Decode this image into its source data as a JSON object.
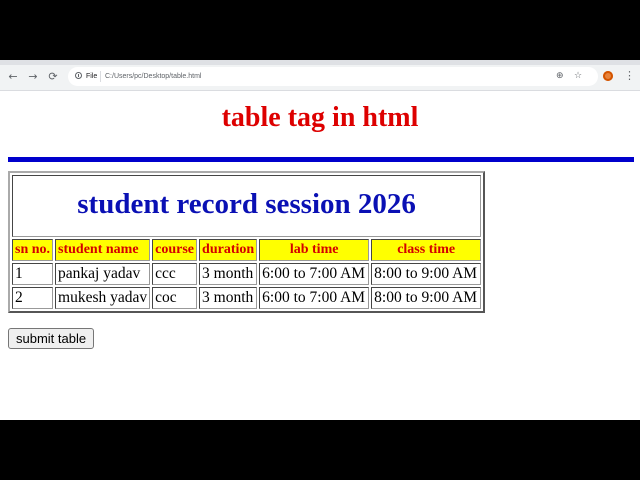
{
  "browser": {
    "file_label": "File",
    "url": "C:/Users/pc/Desktop/table.html",
    "back_glyph": "←",
    "forward_glyph": "→",
    "reload_glyph": "⟳",
    "zoom_glyph": "⊕",
    "star_glyph": "☆",
    "menu_glyph": "⋮"
  },
  "page": {
    "heading": "table tag in html",
    "table": {
      "caption": "student record session 2026",
      "headers": [
        "sn no.",
        "student name",
        "course",
        "duration",
        "lab time",
        "class time"
      ],
      "rows": [
        [
          "1",
          "pankaj yadav",
          "ccc",
          "3 month",
          "6:00 to 7:00 AM",
          "8:00 to 9:00 AM"
        ],
        [
          "2",
          "mukesh yadav",
          "coc",
          "3 month",
          "6:00 to 7:00 AM",
          "8:00 to 9:00 AM"
        ]
      ]
    },
    "submit_label": "submit table"
  },
  "colors": {
    "heading": "#dd0000",
    "rule": "#0000cc",
    "caption": "#0a10b4",
    "header_bg": "#ffff00",
    "header_text": "#d40000"
  }
}
